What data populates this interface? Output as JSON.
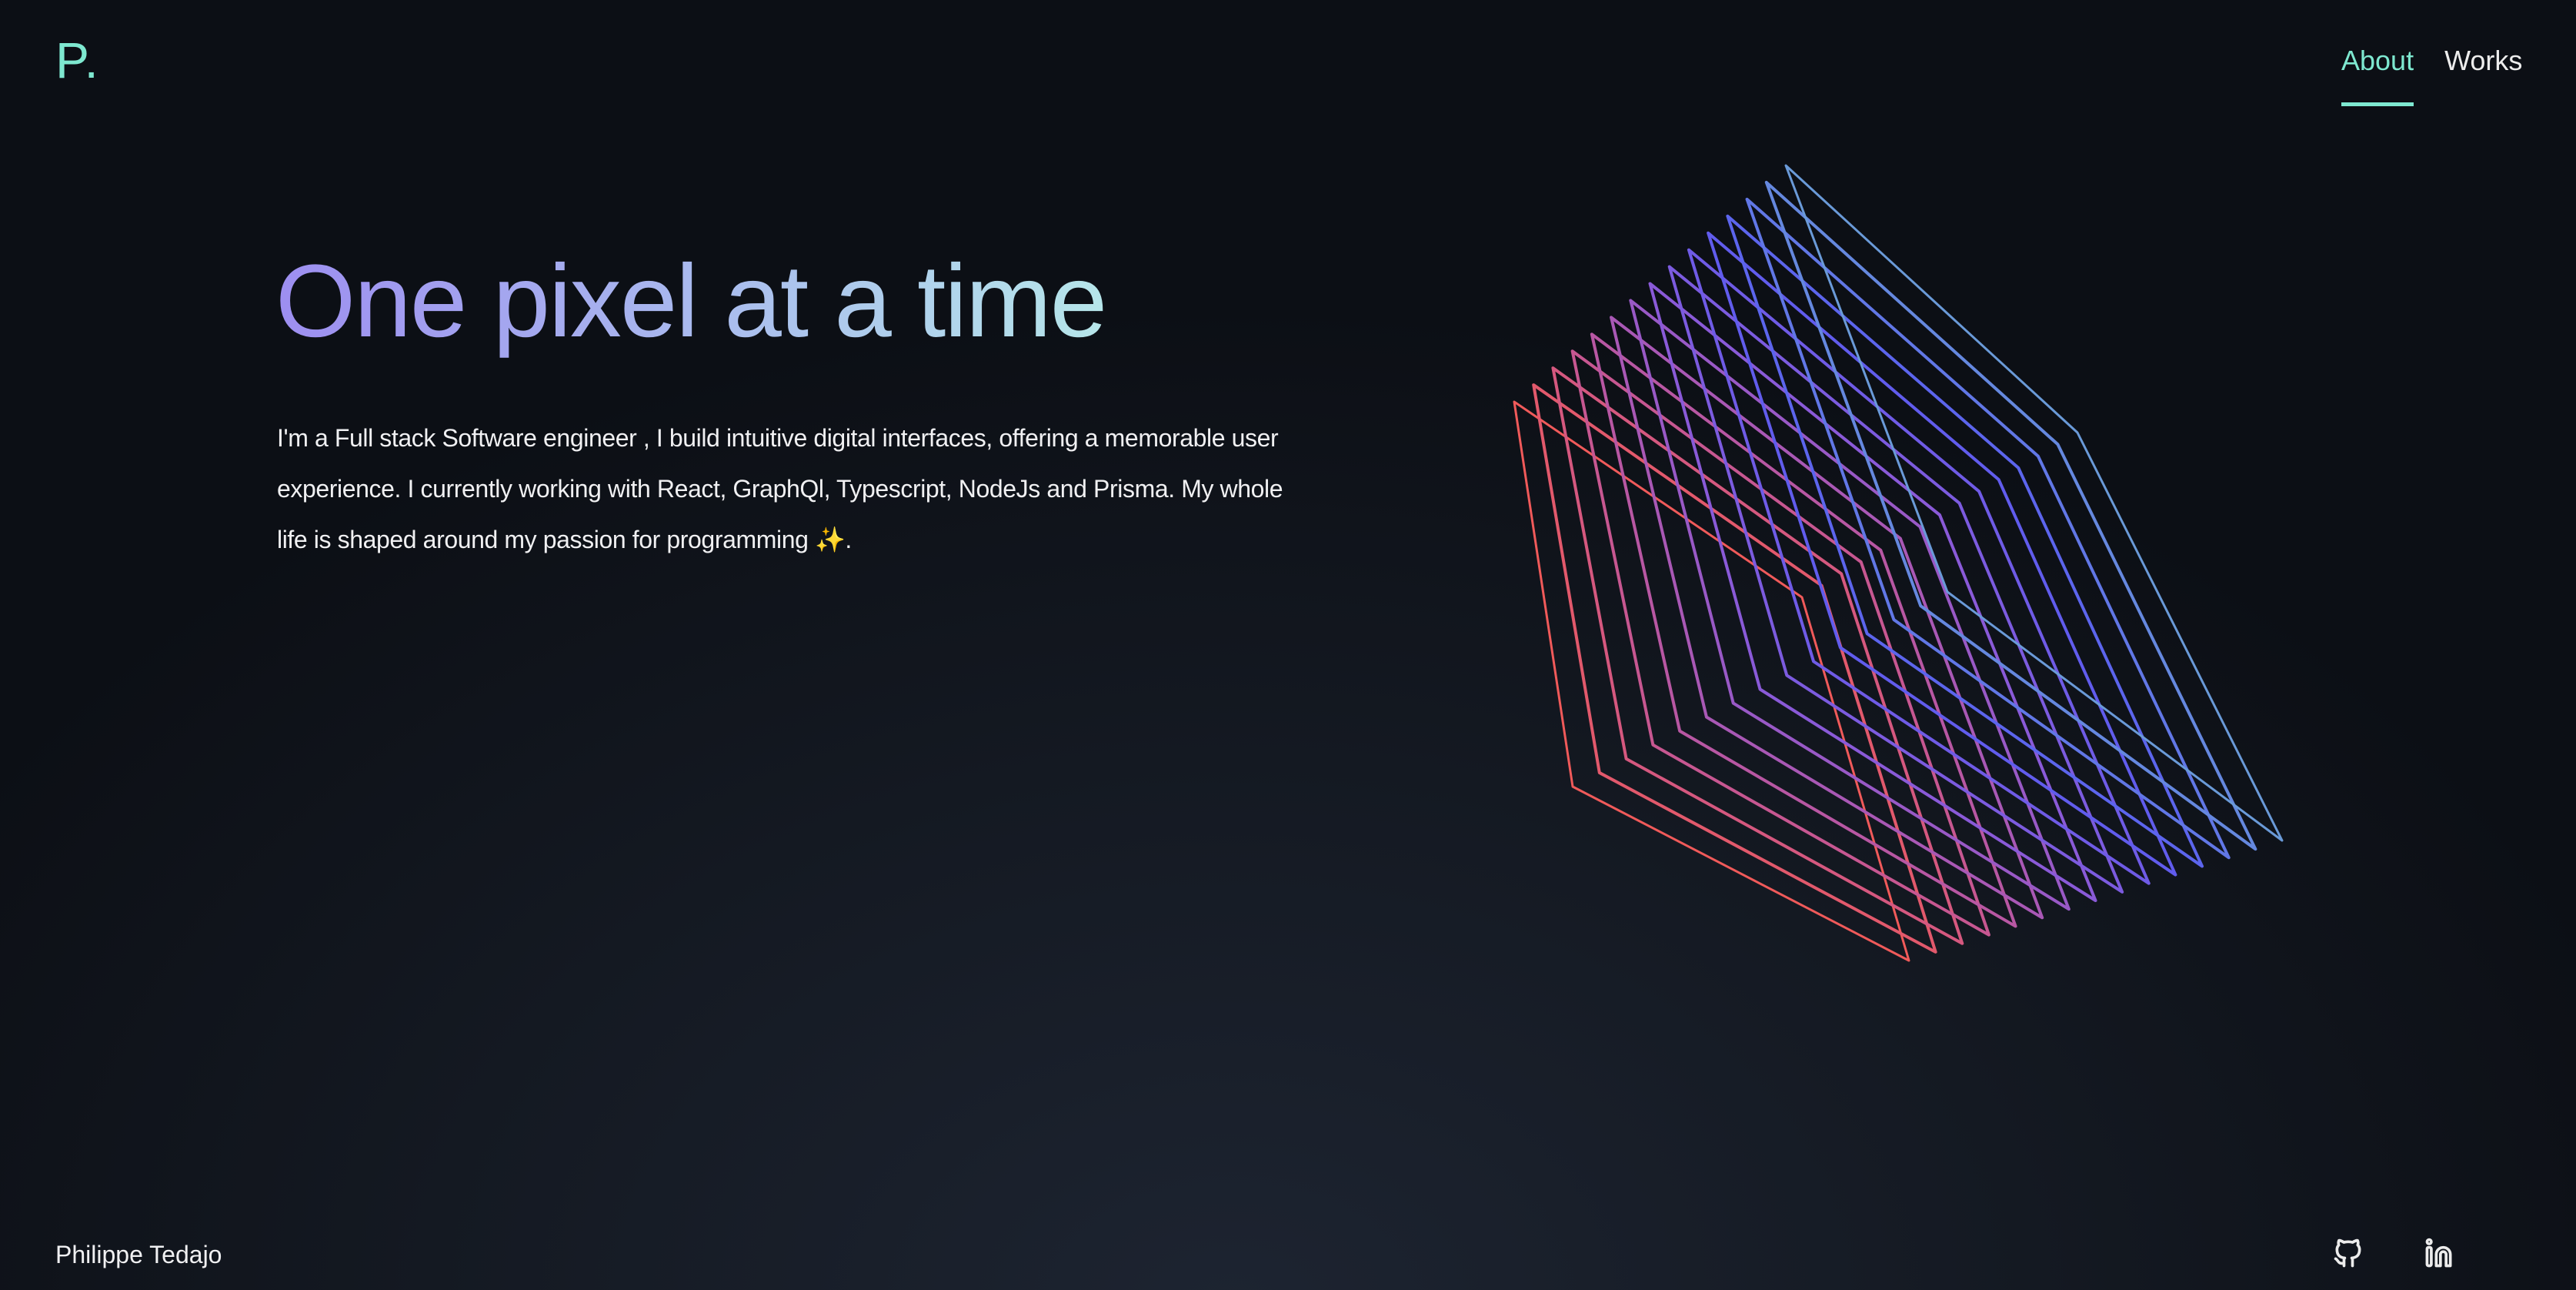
{
  "header": {
    "logo": "P.",
    "nav": [
      {
        "label": "About",
        "active": true
      },
      {
        "label": "Works",
        "active": false
      }
    ]
  },
  "hero": {
    "title": "One pixel at a time",
    "intro": "I'm a Full stack Software engineer , I build intuitive digital interfaces, offering a memorable user experience. I currently working with React, GraphQl, Typescript, NodeJs and Prisma. My whole life is shaped around my passion for programming ✨."
  },
  "footer": {
    "name": "Philippe Tedajo",
    "social": [
      {
        "icon": "github-icon"
      },
      {
        "icon": "linkedin-icon"
      }
    ]
  },
  "colors": {
    "accent": "#7ee8d0",
    "title_gradient": [
      "#9d8ef0",
      "#b6e6ea"
    ],
    "art_gradient": [
      "#f05a5a",
      "#c0569a",
      "#8a5ad8",
      "#5a5cf0",
      "#6a9ad8"
    ]
  }
}
